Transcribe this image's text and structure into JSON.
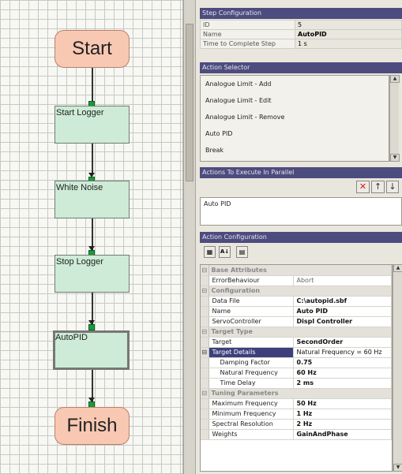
{
  "flow": {
    "start_label": "Start",
    "finish_label": "Finish",
    "steps": [
      {
        "label": "Start Logger"
      },
      {
        "label": "White Noise"
      },
      {
        "label": "Stop Logger"
      },
      {
        "label": "AutoPID"
      }
    ]
  },
  "step_config": {
    "title": "Step Configuration",
    "rows": [
      {
        "key": "ID",
        "value": "5"
      },
      {
        "key": "Name",
        "value": "AutoPID"
      },
      {
        "key": "Time to Complete Step",
        "value": "1 s"
      }
    ]
  },
  "action_selector": {
    "title": "Action Selector",
    "items": [
      "Analogue Limit - Add",
      "Analogue Limit - Edit",
      "Analogue Limit - Remove",
      "Auto PID",
      "Break"
    ]
  },
  "actions_parallel": {
    "title": "Actions To Execute In Parallel",
    "items": [
      "Auto PID"
    ]
  },
  "action_config": {
    "title": "Action Configuration",
    "categories": [
      {
        "name": "Base Attributes",
        "rows": [
          {
            "name": "ErrorBehaviour",
            "value": "Abort"
          }
        ]
      },
      {
        "name": "Configuration",
        "rows": [
          {
            "name": "Data File",
            "value": "C:\\autopid.sbf"
          },
          {
            "name": "Name",
            "value": "Auto PID"
          },
          {
            "name": "ServoController",
            "value": "Displ Controller"
          }
        ]
      },
      {
        "name": "Target Type",
        "rows": [
          {
            "name": "Target",
            "value": "SecondOrder"
          },
          {
            "name": "Target Details",
            "value": "Natural Frequency = 60 Hz"
          },
          {
            "name": "Damping Factor",
            "value": "0.75"
          },
          {
            "name": "Natural Frequency",
            "value": "60 Hz"
          },
          {
            "name": "Time Delay",
            "value": "2 ms"
          }
        ]
      },
      {
        "name": "Tuning Parameters",
        "rows": [
          {
            "name": "Maximum Frequency",
            "value": "50 Hz"
          },
          {
            "name": "Minimum Frequency",
            "value": "1 Hz"
          },
          {
            "name": "Spectral Resolution",
            "value": "2 Hz"
          },
          {
            "name": "Weights",
            "value": "GainAndPhase"
          }
        ]
      }
    ]
  }
}
